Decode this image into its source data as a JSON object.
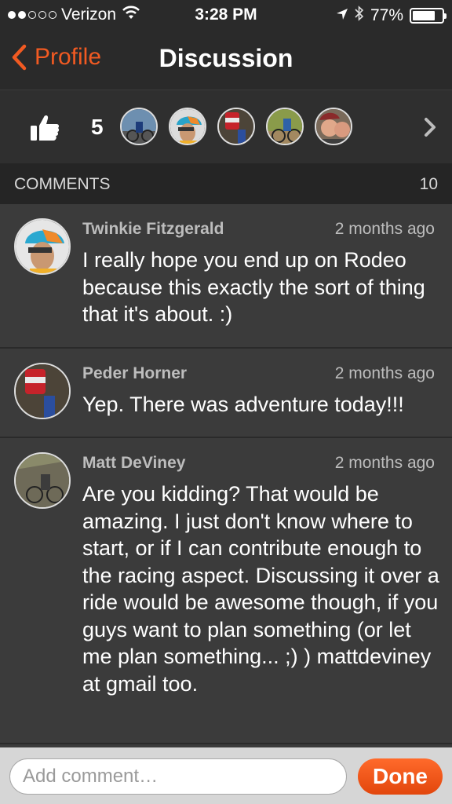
{
  "status_bar": {
    "carrier": "Verizon",
    "time": "3:28 PM",
    "battery": "77%",
    "battery_level": 0.77,
    "signal_bars_filled": 2,
    "signal_bars_total": 5
  },
  "nav": {
    "back_label": "Profile",
    "title": "Discussion"
  },
  "kudos": {
    "count": "5",
    "avatars": [
      "kudos-avatar-1",
      "kudos-avatar-2",
      "kudos-avatar-3",
      "kudos-avatar-4",
      "kudos-avatar-5"
    ]
  },
  "comments_header": {
    "label": "COMMENTS",
    "count": "10"
  },
  "comments": [
    {
      "author": "Twinkie Fitzgerald",
      "time": "2 months ago",
      "text": "I really hope you end up on Rodeo because this exactly the sort of thing that it's about. :)"
    },
    {
      "author": "Peder Horner",
      "time": "2 months ago",
      "text": "Yep. There was adventure today!!!"
    },
    {
      "author": "Matt DeViney",
      "time": "2 months ago",
      "text": "Are you kidding? That would be amazing. I just don't know where to start, or if I can contribute enough to the racing aspect. Discussing it over a ride would be awesome though, if you guys want to plan something (or let me plan something... ;) ) mattdeviney at gmail too."
    }
  ],
  "composer": {
    "placeholder": "Add comment…",
    "done_label": "Done"
  },
  "colors": {
    "accent": "#f15a22",
    "background": "#3b3b3b",
    "bar": "#2a2a2a"
  },
  "icons": [
    "location-arrow-icon",
    "bluetooth-icon",
    "wifi-icon",
    "battery-icon",
    "chevron-left-icon",
    "thumbs-up-icon",
    "chevron-right-icon"
  ]
}
